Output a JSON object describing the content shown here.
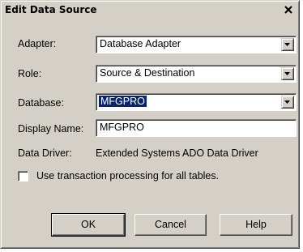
{
  "dialog": {
    "title": "Edit Data Source",
    "close_glyph": "✕"
  },
  "form": {
    "adapter": {
      "label": "Adapter:",
      "value": "Database Adapter"
    },
    "role": {
      "label": "Role:",
      "value": "Source & Destination"
    },
    "database": {
      "label": "Database:",
      "value": "MFGPRO"
    },
    "display_name": {
      "label": "Display Name:",
      "value": "MFGPRO"
    },
    "data_driver": {
      "label": "Data Driver:",
      "value": "Extended Systems ADO Data Driver"
    },
    "transaction": {
      "label": "Use transaction processing for all tables.",
      "checked": false
    }
  },
  "buttons": {
    "ok": "OK",
    "cancel": "Cancel",
    "help": "Help"
  },
  "icons": {
    "dropdown": "chevron-down-icon",
    "close": "close-icon"
  },
  "colors": {
    "face": "#d4d0c8",
    "selection": "#0a246a",
    "field_bg": "#ffffff"
  }
}
